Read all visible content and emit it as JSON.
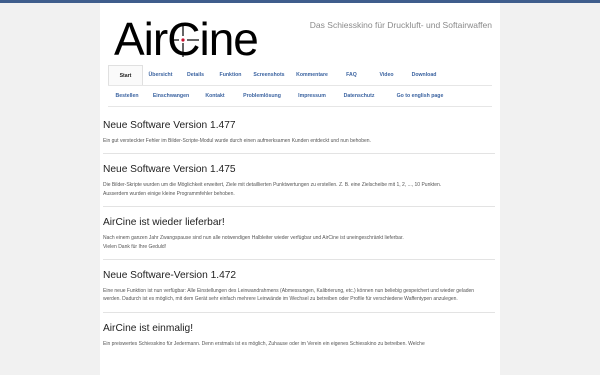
{
  "header": {
    "logo_prefix": "Air",
    "logo_reticle_letter": "C",
    "logo_suffix": "ine",
    "tagline": "Das Schiesskino für Druckluft- und Softairwaffen"
  },
  "nav": {
    "row1": [
      "Start",
      "Übersicht",
      "Details",
      "Funktion",
      "Screenshots",
      "Kommentare",
      "FAQ",
      "Video",
      "Download"
    ],
    "row2": [
      "Bestellen",
      "Einschwangen",
      "Kontakt",
      "Problemlösung",
      "Impressum",
      "Datenschutz",
      "Go to english page"
    ]
  },
  "posts": [
    {
      "title": "Neue Software Version 1.477",
      "lines": [
        "Ein gut versteckter Fehler im Bilder-Scripte-Modul wurde durch einen aufmerksamen Kunden entdeckt und nun behoben."
      ]
    },
    {
      "title": "Neue Software Version 1.475",
      "lines": [
        "Die Bilder-Skripte wurden um die Möglichkeit erweitert, Ziele mit detaillierten Punktwertungen zu erstellen. Z. B. eine Zielscheibe mit 1, 2, ..., 10 Punkten.",
        "Ausserdem wurden einige kleine Programmfehler behoben."
      ]
    },
    {
      "title": "AirCine ist wieder lieferbar!",
      "lines": [
        "Nach einem ganzen Jahr Zwangspause sind nun alle notwendigen Halbleiter wieder verfügbar und AirCine ist uneingeschränkt lieferbar.",
        "Vielen Dank für Ihre Geduld!"
      ]
    },
    {
      "title": "Neue Software-Version 1.472",
      "lines": [
        "Eine neue Funktion ist nun verfügbar: Alle Einstellungen des Leinwandrahmens (Abmessungen, Kalibrierung, etc.) können nun beliebig gespeichert und wieder geladen werden. Dadurch ist es möglich, mit dem Gerät sehr einfach mehrere Leinwände im Wechsel zu betreiben oder Profile für verschiedene Waffentypen anzulegen."
      ]
    },
    {
      "title": "AirCine ist einmalig!",
      "lines": [
        "Ein preiswertes Schiesskino für Jedermann. Denn erstmals ist es möglich, Zuhause oder im Verein ein eigenes Schiesskino zu betreiben. Welche"
      ]
    }
  ]
}
